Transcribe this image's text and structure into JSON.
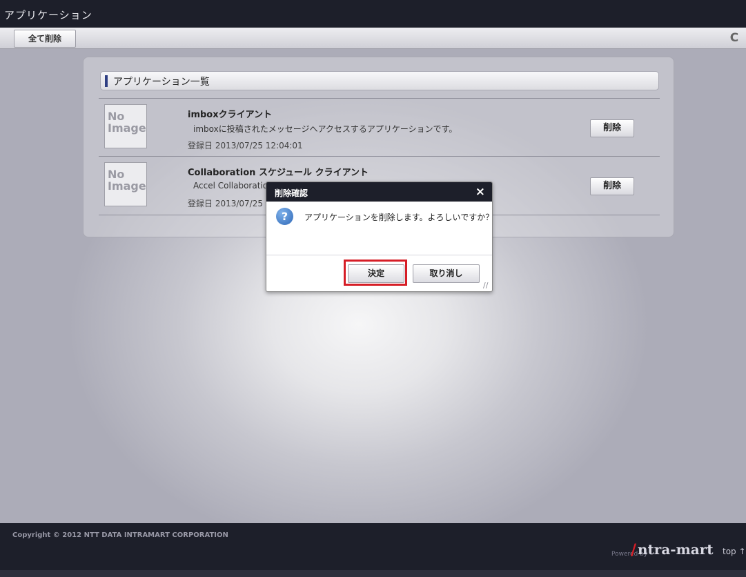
{
  "window": {
    "title": "アプリケーション"
  },
  "toolbar": {
    "delete_all_label": "全て削除",
    "refresh_icon": "refresh-icon",
    "refresh_glyph": "C"
  },
  "panel": {
    "title": "アプリケーション一覧"
  },
  "apps": [
    {
      "thumb_lines": [
        "No",
        "Image"
      ],
      "name": "imboxクライアント",
      "description": "imboxに投稿されたメッセージへアクセスするアプリケーションです。",
      "date": "登録日  2013/07/25 12:04:01",
      "delete_label": "削除"
    },
    {
      "thumb_lines": [
        "No",
        "Image"
      ],
      "name": "Collaboration スケジュール クライアント",
      "description": "Accel Collaboratio",
      "date": "登録日  2013/07/25",
      "delete_label": "削除"
    }
  ],
  "dialog": {
    "title": "削除確認",
    "close_glyph": "×",
    "icon": "question-icon",
    "icon_glyph": "?",
    "message": "アプリケーションを削除します。よろしいですか？",
    "ok_label": "決定",
    "cancel_label": "取り消し",
    "highlight_color": "#d61d26"
  },
  "footer": {
    "copyright": "Copyright © 2012 NTT DATA INTRAMART CORPORATION",
    "powered_by": "Powered by",
    "logo_text": "ntra-mart",
    "top_link": "top ↑"
  }
}
